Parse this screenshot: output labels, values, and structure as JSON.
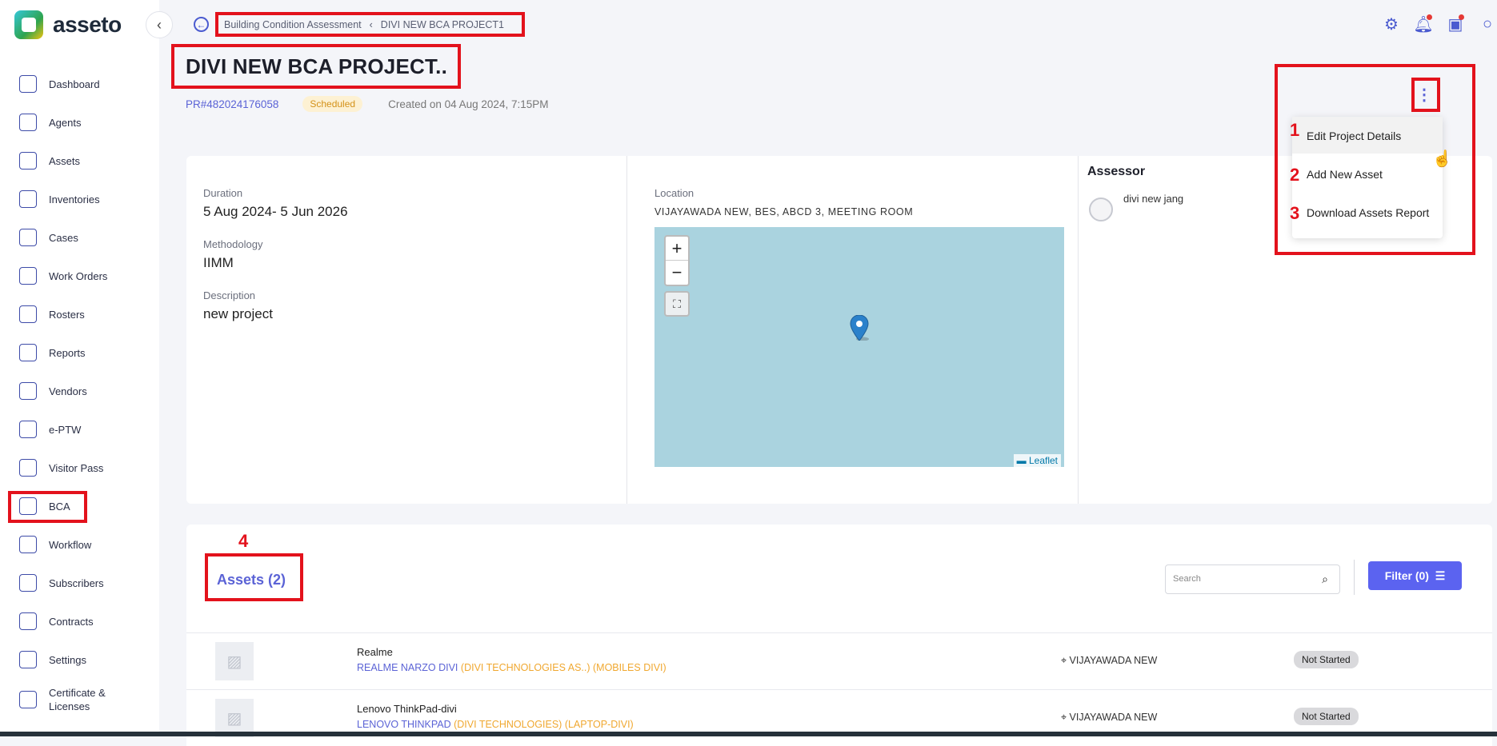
{
  "app": {
    "name": "asseto"
  },
  "sidebar": {
    "items": [
      {
        "label": "Dashboard",
        "icon": "dashboard-icon"
      },
      {
        "label": "Agents",
        "icon": "agents-icon"
      },
      {
        "label": "Assets",
        "icon": "assets-icon"
      },
      {
        "label": "Inventories",
        "icon": "inventories-icon"
      },
      {
        "label": "Cases",
        "icon": "cases-icon"
      },
      {
        "label": "Work Orders",
        "icon": "work-orders-icon"
      },
      {
        "label": "Rosters",
        "icon": "rosters-icon"
      },
      {
        "label": "Reports",
        "icon": "reports-icon"
      },
      {
        "label": "Vendors",
        "icon": "vendors-icon"
      },
      {
        "label": "e-PTW",
        "icon": "eptw-icon"
      },
      {
        "label": "Visitor Pass",
        "icon": "visitor-pass-icon"
      },
      {
        "label": "BCA",
        "icon": "bca-icon"
      },
      {
        "label": "Workflow",
        "icon": "workflow-icon"
      },
      {
        "label": "Subscribers",
        "icon": "subscribers-icon"
      },
      {
        "label": "Contracts",
        "icon": "contracts-icon"
      },
      {
        "label": "Settings",
        "icon": "settings-icon"
      },
      {
        "label": "Certificate & Licenses",
        "icon": "certificate-icon"
      }
    ]
  },
  "breadcrumb": {
    "parent": "Building Condition Assessment",
    "current": "DIVI NEW BCA PROJECT1"
  },
  "project": {
    "title": "DIVI NEW BCA PROJECT..",
    "id": "PR#482024176058",
    "status": "Scheduled",
    "created": "Created on 04 Aug 2024, 7:15PM",
    "duration_label": "Duration",
    "duration": "5 Aug 2024- 5 Jun 2026",
    "methodology_label": "Methodology",
    "methodology": "IIMM",
    "description_label": "Description",
    "description": "new project",
    "location_label": "Location",
    "location": "VIJAYAWADA NEW, BES, ABCD 3, MEETING ROOM",
    "assessor_label": "Assessor",
    "assessor_name": "divi new jang"
  },
  "menu": {
    "items": [
      "Edit Project Details",
      "Add New Asset",
      "Download Assets Report"
    ],
    "numbers": [
      "1",
      "2",
      "3"
    ]
  },
  "map": {
    "zoom_in": "+",
    "zoom_out": "−",
    "attribution": "Leaflet"
  },
  "assets": {
    "title": "Assets (2)",
    "annotation": "4",
    "search_placeholder": "Search",
    "filter_label": "Filter",
    "filter_count": "(0)",
    "rows": [
      {
        "name": "Realme",
        "model": "REALME NARZO DIVI",
        "vendor": "(DIVI TECHNOLOGIES AS..)",
        "category": "(MOBILES DIVI)",
        "location": "VIJAYAWADA NEW",
        "status": "Not Started"
      },
      {
        "name": "Lenovo ThinkPad-divi",
        "model": "LENOVO THINKPAD",
        "vendor": "(DIVI TECHNOLOGIES)",
        "category": "(LAPTOP-DIVI)",
        "location": "VIJAYAWADA NEW",
        "status": "Not Started"
      }
    ]
  },
  "colors": {
    "accent": "#5b63d6",
    "annotation": "#e3121c",
    "status_scheduled": "#fdf1d3"
  }
}
